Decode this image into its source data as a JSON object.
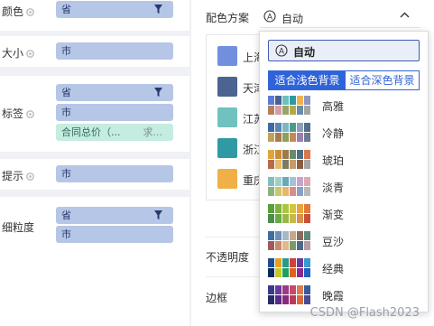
{
  "fields": {
    "color": {
      "label": "颜色",
      "pill": "省"
    },
    "size": {
      "label": "大小",
      "pill": "市"
    },
    "tag": {
      "label": "标签",
      "pills": [
        "省",
        "市",
        "合同总价（...",
        "求..."
      ]
    },
    "tooltip": {
      "label": "提示",
      "pill": "市"
    },
    "granularity": {
      "label": "细粒度",
      "pills": [
        "省",
        "市"
      ]
    }
  },
  "color_settings": {
    "scheme_label": "配色方案",
    "scheme_value": "自动",
    "opacity_label": "不透明度",
    "border_label": "边框",
    "legend_items": [
      {
        "label": "上海",
        "color": "#7090de"
      },
      {
        "label": "天津",
        "color": "#4d6391"
      },
      {
        "label": "江苏",
        "color": "#6fc2bf"
      },
      {
        "label": "浙江",
        "color": "#2f9aa3"
      },
      {
        "label": "重庆",
        "color": "#f0b048"
      }
    ]
  },
  "dropdown": {
    "auto_label": "自动",
    "tabs": {
      "light": "适合浅色背景",
      "dark": "适合深色背景"
    },
    "palettes": [
      {
        "name": "高雅",
        "colors": [
          "#5b7bd5",
          "#4d5f8f",
          "#6fbfbd",
          "#2c9aa3",
          "#f0b14b",
          "#8d98c2",
          "#b57f5e",
          "#d39fa7",
          "#9aa36a",
          "#b0aa4a",
          "#6b8ca8",
          "#a4a4a4"
        ]
      },
      {
        "name": "冷静",
        "colors": [
          "#3e6aa3",
          "#5a86b6",
          "#7db6c2",
          "#4e9a8a",
          "#8a9fb8",
          "#4f6e8f",
          "#c2a25a",
          "#a87a4f",
          "#8ba05e",
          "#c58a54",
          "#9b7fb0",
          "#6b7a8f"
        ]
      },
      {
        "name": "琥珀",
        "colors": [
          "#e0a43c",
          "#c98d3a",
          "#9e7b45",
          "#6a8a6e",
          "#4e6e83",
          "#d9774c",
          "#b86a4a",
          "#e8b96a",
          "#7f7a60",
          "#c69a6a",
          "#8a5d3e",
          "#a6a6a6"
        ]
      },
      {
        "name": "淡青",
        "colors": [
          "#7fc0bd",
          "#9dd1c7",
          "#6aa8b8",
          "#a3c1d9",
          "#c5a6c9",
          "#e0a8b0",
          "#8bb37a",
          "#c9c76a",
          "#e6b86a",
          "#d98c8c",
          "#8aa0c8",
          "#b8b8b8"
        ]
      },
      {
        "name": "渐变",
        "colors": [
          "#5a9e3a",
          "#7fb33e",
          "#a9c640",
          "#d4c43a",
          "#e8a33a",
          "#e07a3a",
          "#4a8e4a",
          "#6aa84a",
          "#9ab84a",
          "#c8b84a",
          "#d8904a",
          "#c8503a"
        ]
      },
      {
        "name": "豆沙",
        "colors": [
          "#3b6fa0",
          "#6b8fb5",
          "#a6b8c8",
          "#c8a88a",
          "#8a6a5a",
          "#5a8a7a",
          "#a05a5a",
          "#c88a6a",
          "#e0b88a",
          "#7a9a6a",
          "#4a6a8a",
          "#b89aa8"
        ]
      },
      {
        "name": "经典",
        "colors": [
          "#1f4e8c",
          "#e8a020",
          "#2a9a8a",
          "#d04040",
          "#6a3a9a",
          "#3a9ad0",
          "#0a2a5a",
          "#c8c820",
          "#20a060",
          "#e06020",
          "#8a2a8a",
          "#2060c0"
        ]
      },
      {
        "name": "晚霞",
        "colors": [
          "#3a3a8a",
          "#6a3a9a",
          "#9a3a8a",
          "#c84a6a",
          "#e07a4a",
          "#3a5aa0",
          "#2a2a6a",
          "#5a2a8a",
          "#8a2a7a",
          "#b83a5a",
          "#d86a3a",
          "#4a4a9a"
        ]
      }
    ]
  },
  "watermark": "CSDN @Flash2023"
}
